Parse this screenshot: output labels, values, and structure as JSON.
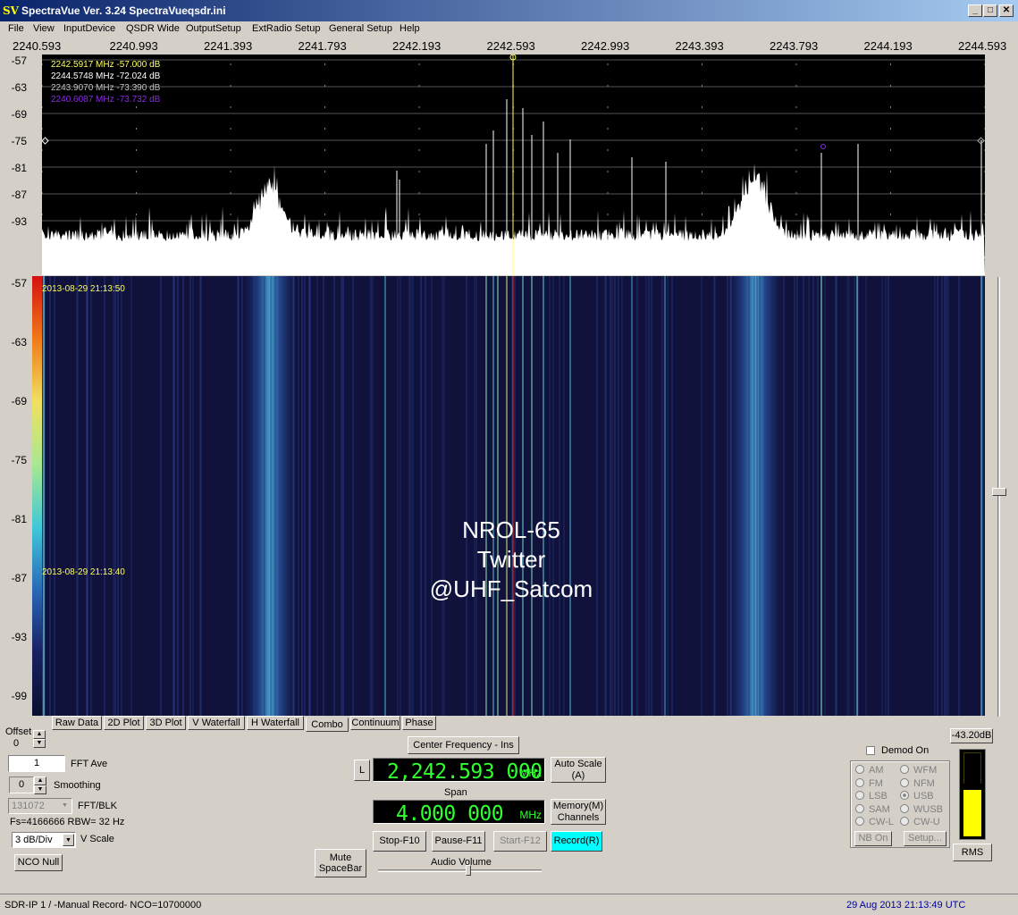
{
  "window": {
    "title": "SpectraVue Ver. 3.24  SpectraVueqsdr.ini",
    "logo": "SV"
  },
  "menu": [
    "File",
    "View",
    "InputDevice",
    "QSDR Wide",
    "OutputSetup",
    "ExtRadio Setup",
    "General Setup",
    "Help"
  ],
  "freq_axis": [
    "2240.593",
    "2240.993",
    "2241.393",
    "2241.793",
    "2242.193",
    "2242.593",
    "2242.993",
    "2243.393",
    "2243.793",
    "2244.193",
    "2244.593"
  ],
  "spectrum_ylabels": [
    "-57",
    "-63",
    "-69",
    "-75",
    "-81",
    "-87",
    "-93"
  ],
  "waterfall_ylabels": [
    "-57",
    "-63",
    "-69",
    "-75",
    "-81",
    "-87",
    "-93",
    "-99"
  ],
  "markers": [
    {
      "text": "2242.5917 MHz  -57.000  dB",
      "color": "#ffff60"
    },
    {
      "text": "2244.5748 MHz  -72.024  dB",
      "color": "#ffffff"
    },
    {
      "text": "2243.9070 MHz  -73.390  dB",
      "color": "#c0c0c0"
    },
    {
      "text": "2240.6087 MHz  -73.732  dB",
      "color": "#8a2be2"
    }
  ],
  "waterfall_times": [
    "2013-08-29 21:13:50",
    "2013-08-29 21:13:40"
  ],
  "overlay": {
    "line1": "NROL-65",
    "line2": "Twitter",
    "line3": "@UHF_Satcom"
  },
  "tabs": [
    "Raw Data",
    "2D Plot",
    "3D Plot",
    "V Waterfall",
    "H Waterfall",
    "Combo",
    "Continuum",
    "Phase"
  ],
  "active_tab": "Combo",
  "left_controls": {
    "offset_label": "Offset",
    "offset_value": "0",
    "fft_ave_value": "1",
    "fft_ave_label": "FFT Ave",
    "smoothing_value": "0",
    "smoothing_label": "Smoothing",
    "fft_blk_value": "131072",
    "fft_blk_label": "FFT/BLK",
    "fs_info": "Fs=4166666 RBW=  32 Hz",
    "vscale_value": "3 dB/Div",
    "vscale_label": "V Scale",
    "nco_null": "NCO Null"
  },
  "center": {
    "center_freq_button": "Center Frequency - Ins",
    "l_button": "L",
    "freq_value": "2,242.593 000",
    "freq_unit": "MHz",
    "auto_scale": "Auto Scale\n(A)",
    "span_label": "Span",
    "span_value": "4.000 000",
    "span_unit": "MHz",
    "memory": "Memory(M)\nChannels",
    "mute": "Mute\nSpaceBar",
    "stop": "Stop-F10",
    "pause": "Pause-F11",
    "start": "Start-F12",
    "record": "Record(R)",
    "audio_volume": "Audio Volume"
  },
  "demod": {
    "level": "-43.20dB",
    "demod_on": "Demod On",
    "modes_left": [
      "AM",
      "FM",
      "LSB",
      "SAM",
      "CW-L"
    ],
    "modes_right": [
      "WFM",
      "NFM",
      "USB",
      "WUSB",
      "CW-U"
    ],
    "selected": "USB",
    "nb_on": "NB On",
    "setup": "Setup...",
    "rms": "RMS",
    "meter_fill": 0.55
  },
  "status": {
    "left": "SDR-IP 1  / -Manual Record-   NCO=10700000",
    "right": "29 Aug 2013  21:13:49 UTC"
  },
  "colors": {
    "record_button": "#00ffff",
    "lcd_text": "#30ff30",
    "meter_yellow": "#ffff00",
    "status_right": "#0000a0"
  }
}
